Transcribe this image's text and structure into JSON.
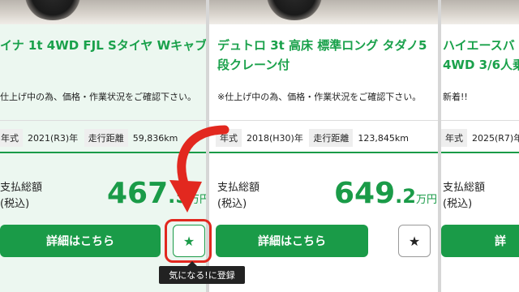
{
  "cards": [
    {
      "title_line1": "イナ 1t 4WD FJL Sタイヤ Wキャブ",
      "title_line2": "",
      "note": "仕上げ中の為、価格・作業状況をご確認下さい。",
      "year_label": "年式",
      "year_value": "2021(R3)年",
      "mileage_label": "走行距離",
      "mileage_value": "59,836km",
      "price_label_1": "支払総額",
      "price_label_2": "(税込)",
      "price_int": "467",
      "price_dec": ".5",
      "price_unit": "万円",
      "detail_label": "詳細はこちら",
      "favorite_icon": "star-icon"
    },
    {
      "title_line1": "デュトロ 3t 高床 標準ロング タダノ5",
      "title_line2": "段クレーン付",
      "note": "※仕上げ中の為、価格・作業状況をご確認下さい。",
      "year_label": "年式",
      "year_value": "2018(H30)年",
      "mileage_label": "走行距離",
      "mileage_value": "123,845km",
      "price_label_1": "支払総額",
      "price_label_2": "(税込)",
      "price_int": "649",
      "price_dec": ".2",
      "price_unit": "万円",
      "detail_label": "詳細はこちら",
      "favorite_icon": "star-icon"
    },
    {
      "title_line1": "ハイエースバ",
      "title_line2": "4WD 3/6人乗",
      "note": "新着!!",
      "year_label": "年式",
      "year_value": "2025(R7)年",
      "price_label_1": "支払総額",
      "price_label_2": "(税込)",
      "detail_label": "詳"
    }
  ],
  "tooltip": "気になる!に登録",
  "colors": {
    "brand_green": "#1a9b48",
    "highlight_red": "#e2281f",
    "tooltip_bg": "#222222"
  }
}
